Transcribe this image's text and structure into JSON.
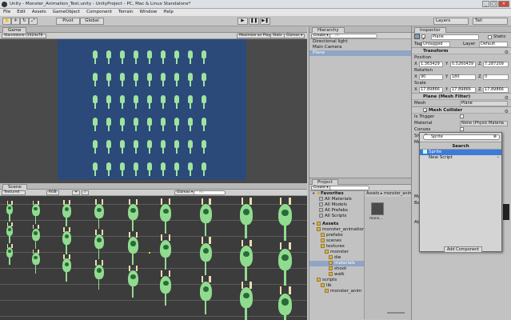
{
  "window": {
    "title": "Unity - Monster_Animation_Test.unity - UnityProject - PC, Mac & Linux Standalone*",
    "btn_min": "_",
    "btn_max": "□",
    "btn_close": "✕"
  },
  "menu": [
    "File",
    "Edit",
    "Assets",
    "GameObject",
    "Component",
    "Terrain",
    "Window",
    "Help"
  ],
  "toolbar": {
    "pivot": "Pivot",
    "global": "Global",
    "layers": "Layers",
    "layout": "Tall",
    "play": "▶",
    "pause": "❚❚",
    "step": "▶❚"
  },
  "game": {
    "tab": "Game",
    "resolution": "Standalone (1024x76",
    "maximize": "Maximize on Play",
    "stats": "Stats",
    "gizmos": "Gizmos ▾",
    "bg": "#2b4a7a"
  },
  "scene": {
    "tab": "Scene",
    "render": "Textured",
    "rgb": "RGB",
    "gizmos": "Gizmos ▾",
    "search": "All"
  },
  "hierarchy": {
    "tab": "Hierarchy",
    "create": "Create ▾",
    "search": "All",
    "items": [
      "Directional light",
      "Main Camera",
      "Plane"
    ],
    "selected": 2
  },
  "project": {
    "tab": "Project",
    "create": "Create ▾",
    "favorites": "Favorites",
    "fav_items": [
      "All Materials",
      "All Models",
      "All Prefabs",
      "All Scripts"
    ],
    "assets": "Assets",
    "tree": [
      {
        "label": "monster_animation",
        "indent": 1
      },
      {
        "label": "prefabs",
        "indent": 2
      },
      {
        "label": "scenes",
        "indent": 2
      },
      {
        "label": "textures",
        "indent": 2
      },
      {
        "label": "monster",
        "indent": 3
      },
      {
        "label": "die",
        "indent": 4
      },
      {
        "label": "materials",
        "indent": 4,
        "sel": true
      },
      {
        "label": "shoot",
        "indent": 4
      },
      {
        "label": "walk",
        "indent": 4
      },
      {
        "label": "scripts",
        "indent": 1
      },
      {
        "label": "lib",
        "indent": 2
      },
      {
        "label": "monster_anim",
        "indent": 3
      }
    ],
    "breadcrumb": "Assets ▸ monster_anim",
    "asset_thumb_label": "mons..."
  },
  "inspector": {
    "tab": "Inspector",
    "name": "Plane",
    "static": "Static",
    "tag_label": "Tag",
    "tag": "Untagged",
    "layer_label": "Layer",
    "layer": "Default",
    "transform": "Transform",
    "position": "Position",
    "pos": {
      "x": "1.363429",
      "y": "0.5260439",
      "z": "7.287209"
    },
    "rotation": "Rotation",
    "rot": {
      "x": "90",
      "y": "180",
      "z": "0"
    },
    "scale": "Scale",
    "scl": {
      "x": "17.89866",
      "y": "17.89866",
      "z": "17.89866"
    },
    "meshfilter": "Plane (Mesh Filter)",
    "mesh_label": "Mesh",
    "mesh": "Plane",
    "meshcollider": "Mesh Collider",
    "is_trigger": "Is Trigger",
    "material_label": "Material",
    "material": "None (Physic Materia",
    "convex": "Convex",
    "sm": "Sm",
    "me": "Me",
    "ma": "Ma",
    "ba": "Ba",
    "al": "Alp"
  },
  "popup": {
    "search": "Sprite",
    "title": "Search",
    "items": [
      "Sprite",
      "New Script"
    ],
    "selected": 0,
    "add_component": "Add Component"
  }
}
